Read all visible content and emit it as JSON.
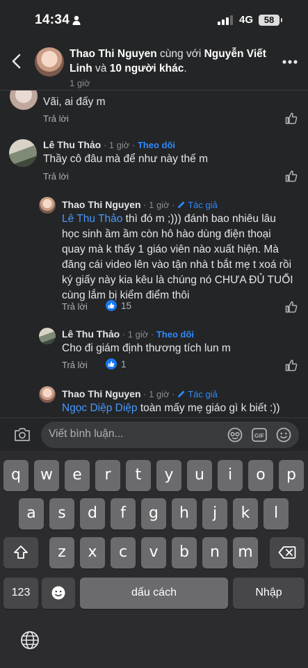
{
  "status_bar": {
    "time": "14:34",
    "network": "4G",
    "battery": "58"
  },
  "header": {
    "name": "Thao Thi Nguyen",
    "with_text": " cùng với ",
    "partner": "Nguyễn Viết Linh",
    "and_text": " và ",
    "others": "10 người khác",
    "period": ".",
    "time": "1 giờ"
  },
  "comments": [
    {
      "text": "Vãi, ai đấy m",
      "reply_label": "Trả lời"
    },
    {
      "name": "Lê Thu Thảo",
      "time": "1 giờ",
      "follow": "Theo dõi",
      "text": "Thầy cô đâu mà để như này thế m",
      "reply_label": "Trả lời"
    },
    {
      "name": "Thao Thi Nguyen",
      "time": "1 giờ",
      "author_badge": "Tác giả",
      "mention": "Lê Thu Thảo",
      "lines": [
        " thì đó m ;))) đánh bao nhiêu lâu",
        "học sinh ầm ầm còn hô hào dùng điện thoại",
        "quay mà k thấy 1 giáo viên nào xuất hiện. Mà",
        "đăng cái video lên vào tận nhà t bắt mẹ t xoá rồi",
        "ký giấy này kia kêu là chúng nó CHƯA ĐỦ TUỔI",
        "cùng lắm bị kiểm điểm thôi"
      ],
      "reply_label": "Trả lời",
      "reactions": "15"
    },
    {
      "name": "Lê Thu Thảo",
      "time": "1 giờ",
      "follow": "Theo dõi",
      "text": "Cho đi giám định thương tích lun m",
      "reply_label": "Trả lời",
      "reactions": "1"
    },
    {
      "name": "Thao Thi Nguyen",
      "time": "1 giờ",
      "author_badge": "Tác giả",
      "mention": "Ngọc Diệp Diệp",
      "text": " toàn mấy mẹ giáo gì k biết :))"
    }
  ],
  "separator": " · ",
  "composer": {
    "placeholder": "Viết bình luận..."
  },
  "keyboard": {
    "row1": [
      "q",
      "w",
      "e",
      "r",
      "t",
      "y",
      "u",
      "i",
      "o",
      "p"
    ],
    "row2": [
      "a",
      "s",
      "d",
      "f",
      "g",
      "h",
      "j",
      "k",
      "l"
    ],
    "row3": [
      "z",
      "x",
      "c",
      "v",
      "b",
      "n",
      "m"
    ],
    "numbers_key": "123",
    "space_key": "dấu cách",
    "return_key": "Nhập"
  },
  "colors": {
    "background": "#242526",
    "link": "#2e89ff",
    "reaction": "#1877f2"
  },
  "icons": [
    "person-icon",
    "signal-icon",
    "back-chevron-icon",
    "more-icon",
    "like-icon",
    "camera-icon",
    "sticker-icon",
    "gif-icon",
    "emoji-icon",
    "shift-icon",
    "backspace-icon",
    "emoji-key-icon",
    "globe-icon"
  ]
}
